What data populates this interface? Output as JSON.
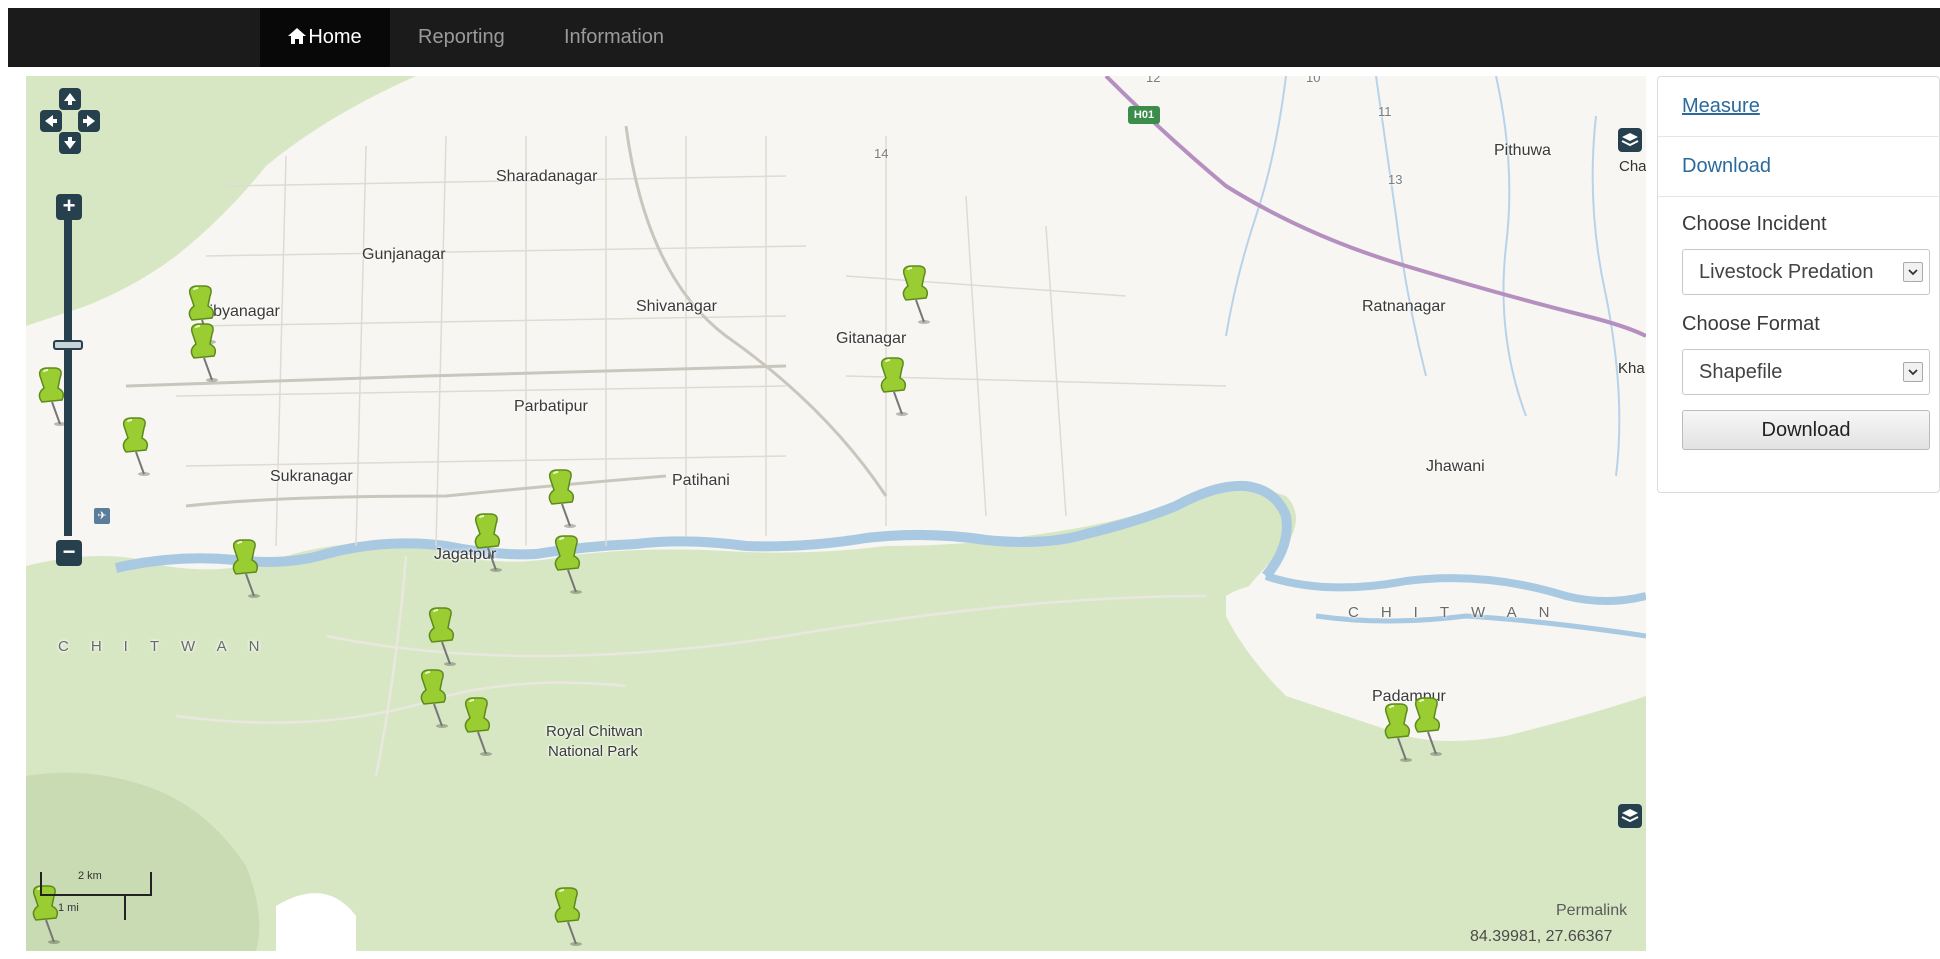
{
  "nav": {
    "home": "Home",
    "reporting": "Reporting",
    "information": "Information"
  },
  "map": {
    "places": {
      "sharadanagar": "Sharadanagar",
      "gunjanagar": "Gunjanagar",
      "dibyanagar": "Dibyanagar",
      "shivanagar": "Shivanagar",
      "gitanagar": "Gitanagar",
      "parbatipur": "Parbatipur",
      "sukranagar": "Sukranagar",
      "patihani": "Patihani",
      "jagatpur": "Jagatpur",
      "chitwan_west": "CHITWAN",
      "royal_chitwan": "Royal Chitwan",
      "national_park": "National Park",
      "ratnanagar": "Ratnanagar",
      "pithuwa": "Pithuwa",
      "jhawani": "Jhawani",
      "chitwan_east": "CHITWAN",
      "padampur": "Padampur",
      "num_14": "14",
      "num_13": "13",
      "num_11": "11",
      "num_12": "12",
      "num_10": "10",
      "cha": "Cha",
      "kha": "Kha"
    },
    "road_shield": "H01",
    "scale": {
      "km": "2 km",
      "mi": "1 mi"
    },
    "permalink": "Permalink",
    "coordinates": "84.39981, 27.66367",
    "icons": {
      "pin": "green-pushpin-icon",
      "layers": "layers-icon",
      "airport": "airport-icon"
    },
    "colors": {
      "park_green": "#d7e7c4",
      "river_blue": "#a9c9e3",
      "urban": "#f7f6f2",
      "pin_green": "#9acd32",
      "control": "#26404e"
    }
  },
  "panel": {
    "measure": "Measure",
    "download_link": "Download",
    "choose_incident": "Choose Incident",
    "incident_value": "Livestock Predation",
    "choose_format": "Choose Format",
    "format_value": "Shapefile",
    "download_button": "Download"
  }
}
